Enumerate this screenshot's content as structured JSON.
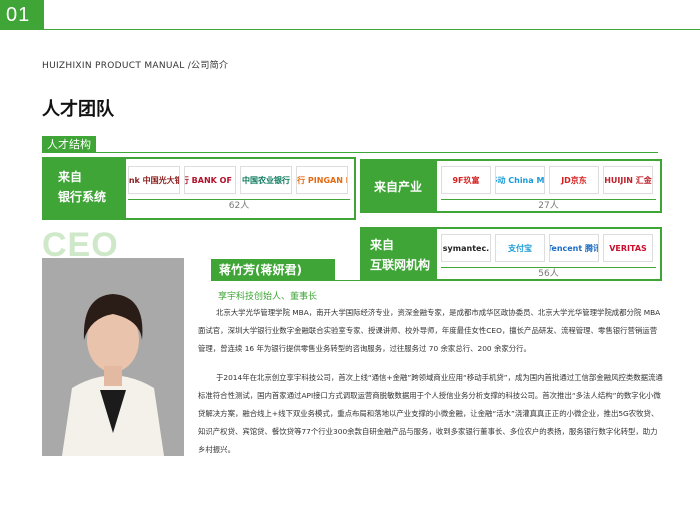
{
  "page": {
    "number": "01",
    "header": "HUIZHIXIN PRODUCT MANUAL /公司简介",
    "section_title": "人才团队",
    "subsection_tab": "人才结构"
  },
  "colors": {
    "accent": "#3ea536",
    "accent_light": "#cfe8c9"
  },
  "groups": {
    "bank": {
      "label_line1": "来自",
      "label_line2": "银行系统",
      "count": "62人",
      "logos": [
        {
          "text": "Bank 中国光大银行",
          "color": "#8b1c1c",
          "icon": "everbright-bank-logo"
        },
        {
          "text": "中国银行 BANK OF CHINA",
          "color": "#b3102a",
          "icon": "bank-of-china-logo"
        },
        {
          "text": "中国农业银行",
          "color": "#0a7a5c",
          "icon": "agricultural-bank-logo"
        },
        {
          "text": "平安银行 PINGAN BANK",
          "color": "#e46a12",
          "icon": "pingan-bank-logo"
        }
      ]
    },
    "industry": {
      "label": "来自产业",
      "count": "27人",
      "logos": [
        {
          "text": "9F玖富",
          "color": "#d61e1e",
          "icon": "9f-logo"
        },
        {
          "text": "中国移动 China Mobile",
          "color": "#1a9ad8",
          "icon": "china-mobile-logo"
        },
        {
          "text": "JD京东",
          "color": "#d61e1e",
          "icon": "jd-logo"
        },
        {
          "text": "HUIJIN 汇金",
          "color": "#c0202a",
          "icon": "huijin-logo"
        }
      ]
    },
    "internet": {
      "label_line1": "来自",
      "label_line2": "互联网机构",
      "count": "56人",
      "logos": [
        {
          "text": "symantec.",
          "color": "#222222",
          "icon": "symantec-logo"
        },
        {
          "text": "支付宝",
          "color": "#1a9ad8",
          "icon": "alipay-logo"
        },
        {
          "text": "Tencent 腾讯",
          "color": "#1b6cc4",
          "icon": "tencent-logo"
        },
        {
          "text": "VERITAS",
          "color": "#c8102e",
          "icon": "veritas-logo"
        }
      ]
    }
  },
  "ceo": {
    "watermark": "CEO",
    "name": "蒋竹芳(蒋妍君)",
    "role": "享宇科技创始人、董事长",
    "paragraphs": [
      "北京大学光华管理学院 MBA，南开大学国际经济专业，资深金融专家，是成都市成华区政协委员、北京大学光华管理学院成都分院 MBA 面试官，深圳大学银行业数字金融联合实验室专家、授课讲师、校外导师，年度最佳女性CEO，擅长产品研发、流程管理、零售银行营销运营管理，曾连续 16 年为银行提供零售业务转型的咨询服务，过往服务过 70 余家总行、200 余家分行。",
      "于2014年在北京创立享宇科技公司，首次上线“通信+金融”跨领域商业应用“移动手机贷”，成为国内首批通过工信部金融风控类数据流通标准符合性测试，国内首家通过API接口方式调取运营商脱敏数据用于个人授信业务分析支撑的科技公司。首次推出“多法人结构”的数字化小微贷解决方案，融合线上+线下双业务模式，重点布局和落地以产业支撑的小微金融，让金融“活水”浇灌真真正正的小微企业，推出5G农牧贷、知识产权贷、宾馆贷、餐饮贷等77个行业300余款自研金融产品与服务，收到多家银行董事长、多位农户的表扬，服务银行数字化转型，助力乡村振兴。"
    ]
  }
}
